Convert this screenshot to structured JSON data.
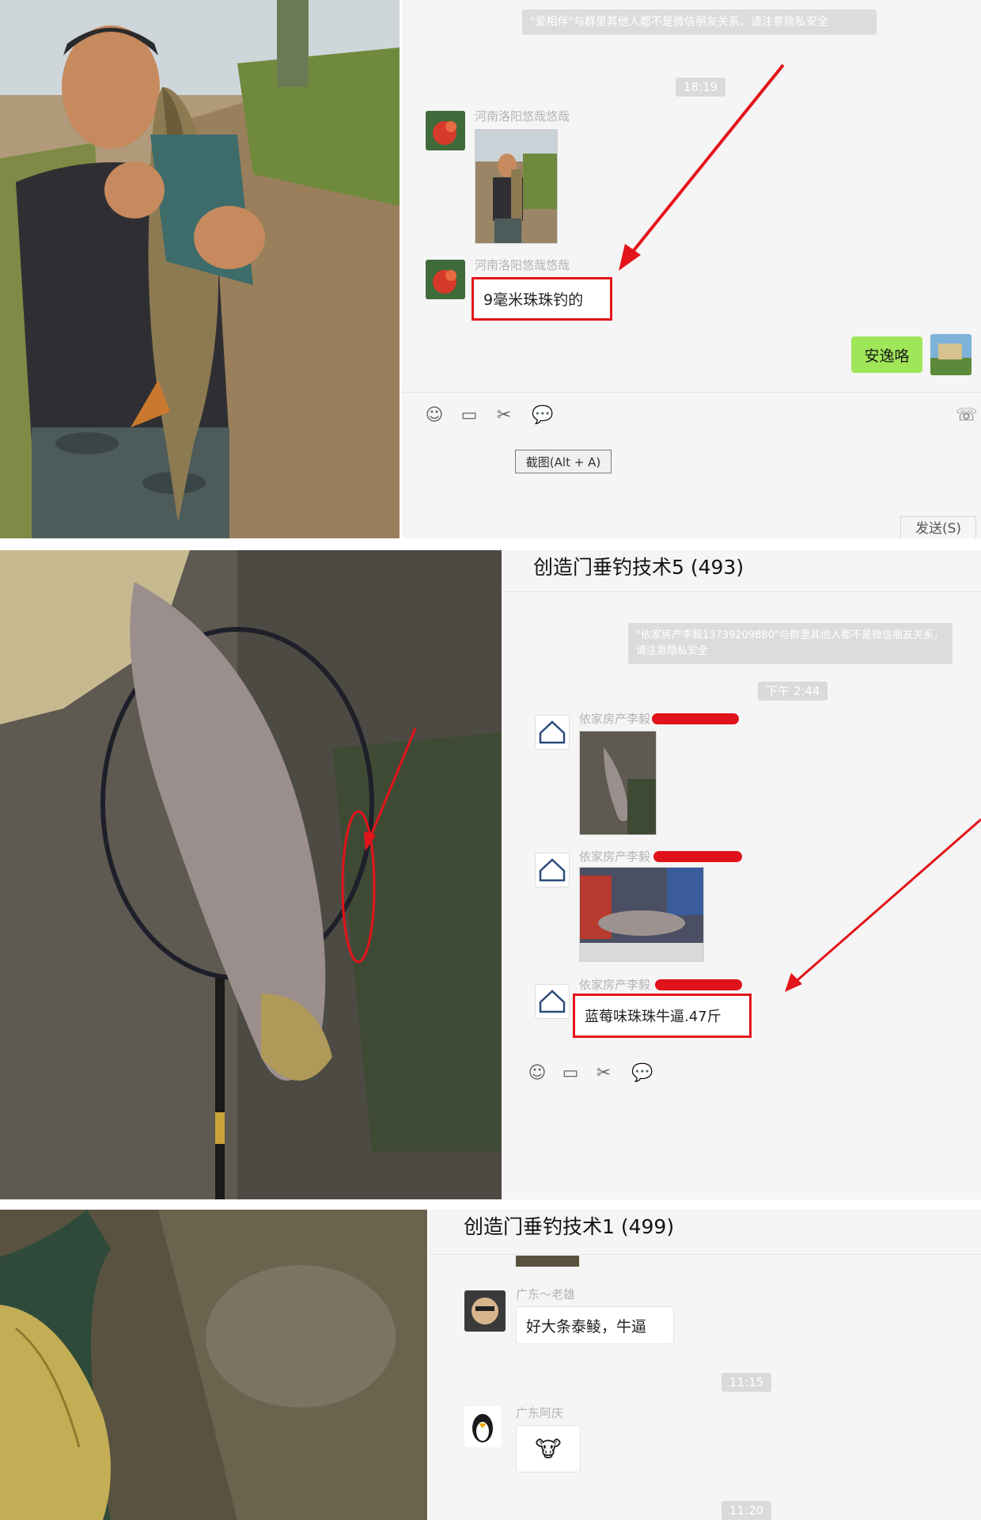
{
  "panel1": {
    "notice": "\"爱相伴\"与群里其他人都不是微信朋友关系，请注意隐私安全",
    "time": "18:19",
    "sender1": "河南洛阳悠哉悠哉",
    "sender2": "河南洛阳悠哉悠哉",
    "message": "9毫米珠珠钓的",
    "my_message": "安逸咯",
    "screenshot_button": "截图(Alt + A)",
    "send_button": "发送(S)"
  },
  "panel2": {
    "title": "创造门垂钓技术5 (493)",
    "notice": "\"依家房产李毅13739209880\"与群里其他人都不是微信朋友关系，请注意隐私安全",
    "time": "下午 2:44",
    "sender": "依家房产李毅",
    "message": "蓝莓味珠珠牛逼.47斤"
  },
  "panel3": {
    "title": "创造门垂钓技术1 (499)",
    "sender1": "广东～老雄",
    "message1": "好大条泰鲮，牛逼",
    "time1": "11:15",
    "sender2": "广东阿庆",
    "time2": "11:20"
  },
  "colors": {
    "annotation_red": "#e3141a",
    "chat_bg": "#f5f5f5",
    "my_bubble": "#9fe658"
  },
  "icons": [
    "emoji-icon",
    "folder-icon",
    "scissors-icon",
    "chat-bubble-icon",
    "phone-icon"
  ]
}
